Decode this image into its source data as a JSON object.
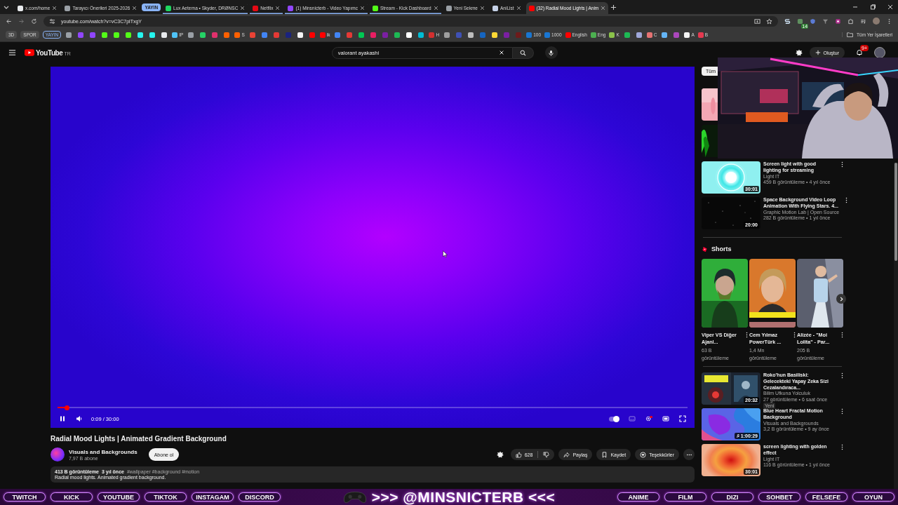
{
  "browser": {
    "tabs": [
      {
        "kind": "tab",
        "title": "x.com/home",
        "selected": false,
        "grouped": false,
        "color": "#e8eaed"
      },
      {
        "kind": "tab",
        "title": "Tarayıcı Önerileri 2025-2026",
        "selected": false,
        "grouped": false,
        "color": "#9aa0a6"
      },
      {
        "kind": "group",
        "title": "YAYIN",
        "color": "#8ab4f8"
      },
      {
        "kind": "tab",
        "title": "Lux Aeterna • Skyder, DRØNSC",
        "selected": false,
        "grouped": true,
        "color": "#1ed760"
      },
      {
        "kind": "tab",
        "title": "Netflix",
        "selected": false,
        "grouped": true,
        "color": "#e50914"
      },
      {
        "kind": "tab",
        "title": "(1) Minsnicterb - Video Yapımc",
        "selected": false,
        "grouped": true,
        "color": "#9146ff"
      },
      {
        "kind": "tab",
        "title": "Stream - Kick Dashboard",
        "selected": false,
        "grouped": true,
        "color": "#53fc18"
      },
      {
        "kind": "tab",
        "title": "Yeni Sekme",
        "selected": false,
        "grouped": false,
        "color": "#9aa0a6"
      },
      {
        "kind": "tab",
        "title": "AniList",
        "selected": false,
        "grouped": false,
        "color": "#c6d2e8"
      },
      {
        "kind": "tab",
        "title": "(32) Radial Mood Lights | Anim",
        "selected": true,
        "grouped": false,
        "color": "#ff0000"
      }
    ],
    "address": "youtube.com/watch?v=vC3C7plTxgY",
    "extension_badge": "14",
    "bookmarks": [
      {
        "kind": "folder",
        "label": "3D"
      },
      {
        "kind": "folder",
        "label": "SPOR"
      },
      {
        "kind": "group",
        "label": "YAYIN",
        "color": "#8ab4f8"
      },
      {
        "kind": "site",
        "color": "#9aa0a6"
      },
      {
        "kind": "site",
        "color": "#9146ff"
      },
      {
        "kind": "site",
        "color": "#9146ff"
      },
      {
        "kind": "site",
        "color": "#53fc18"
      },
      {
        "kind": "site",
        "color": "#53fc18"
      },
      {
        "kind": "site",
        "color": "#53fc18"
      },
      {
        "kind": "site",
        "color": "#25f4ee"
      },
      {
        "kind": "site",
        "color": "#25f4ee"
      },
      {
        "kind": "site",
        "color": "#e8eaed"
      },
      {
        "kind": "site",
        "color": "#4fc3f7",
        "label": "IP"
      },
      {
        "kind": "site",
        "color": "#9aa0a6"
      },
      {
        "kind": "site",
        "color": "#25d366"
      },
      {
        "kind": "site",
        "color": "#e1306c"
      },
      {
        "kind": "site",
        "color": "#ff6000"
      },
      {
        "kind": "site",
        "color": "#ff6000",
        "label": "S"
      },
      {
        "kind": "site",
        "color": "#ea4335"
      },
      {
        "kind": "site",
        "color": "#4285f4"
      },
      {
        "kind": "site",
        "color": "#e53935"
      },
      {
        "kind": "site",
        "color": "#1a237e"
      },
      {
        "kind": "site",
        "color": "#f5f5f5"
      },
      {
        "kind": "site",
        "color": "#ff0000"
      },
      {
        "kind": "site",
        "color": "#ff0000",
        "label": "ik"
      },
      {
        "kind": "site",
        "color": "#4285f4"
      },
      {
        "kind": "site",
        "color": "#e53935"
      },
      {
        "kind": "site",
        "color": "#00c853"
      },
      {
        "kind": "site",
        "color": "#e91e63"
      },
      {
        "kind": "site",
        "color": "#7b1fa2"
      },
      {
        "kind": "site",
        "color": "#1db954"
      },
      {
        "kind": "site",
        "color": "#ffffff"
      },
      {
        "kind": "site",
        "color": "#00bcd4"
      },
      {
        "kind": "site",
        "color": "#d32f2f",
        "label": "H"
      },
      {
        "kind": "site",
        "color": "#9e9e9e"
      },
      {
        "kind": "site",
        "color": "#3f51b5"
      },
      {
        "kind": "site",
        "color": "#bdbdbd"
      },
      {
        "kind": "site",
        "color": "#1565c0"
      },
      {
        "kind": "site",
        "color": "#fdd835"
      },
      {
        "kind": "site",
        "color": "#7b1fa2"
      },
      {
        "kind": "site",
        "color": "#6d1b1b"
      },
      {
        "kind": "site",
        "color": "#1976d2",
        "label": "100"
      },
      {
        "kind": "site",
        "color": "#1976d2",
        "label": "1000"
      },
      {
        "kind": "site",
        "color": "#ff0000",
        "label": "English"
      },
      {
        "kind": "site",
        "color": "#4caf50",
        "label": "Eng"
      },
      {
        "kind": "site",
        "color": "#8bc34a",
        "label": "K"
      },
      {
        "kind": "site",
        "color": "#1db954"
      },
      {
        "kind": "site",
        "color": "#9fa8da"
      },
      {
        "kind": "site",
        "color": "#e57373",
        "label": "C"
      },
      {
        "kind": "site",
        "color": "#64b5f6"
      },
      {
        "kind": "site",
        "color": "#ab47bc"
      },
      {
        "kind": "site",
        "color": "#f5f5f5",
        "label": "A"
      },
      {
        "kind": "site",
        "color": "#e53950",
        "label": "B"
      }
    ],
    "all_bookmarks": "Tüm Yer İşaretleri"
  },
  "youtube": {
    "logo": "YouTube",
    "region": "TR",
    "search": {
      "value": "valorant ayakashi"
    },
    "create": "Oluştur",
    "notifications": "9+"
  },
  "player": {
    "progress": {
      "level": 0.015
    },
    "time": "0:09 / 30:00",
    "playing": true,
    "autoplay": true
  },
  "video": {
    "title": "Radial Mood Lights | Animated Gradient Background",
    "channel": "Visuals and Backgrounds",
    "subscribers": "7,97 B abone",
    "subscribe": "Abone ol",
    "likes": "628",
    "actions": [
      {
        "kind": "share",
        "label": "Paylaş"
      },
      {
        "kind": "save",
        "label": "Kaydet"
      },
      {
        "kind": "thanks",
        "label": "Teşekkürler"
      }
    ],
    "description": {
      "views": "413 B görüntüleme",
      "age": "3 yıl önce",
      "tags": "#wallpaper #background #motion",
      "text": "Radial mood lights. Animated gradient background."
    }
  },
  "sidebar": {
    "chip": "Tüm",
    "videos": [
      {
        "title": "Screen light with good lighting for streaming",
        "channel": "Light IT",
        "meta": "459 B görüntüleme • 4 yıl önce",
        "duration": "30:01"
      },
      {
        "title": "Space Background Video Loop Animation With Flying Stars. 4...",
        "channel": "Graphic Motion Lab | Open Source",
        "meta": "282 B görüntüleme • 1 yıl önce",
        "duration": "20:00"
      }
    ],
    "shorts": {
      "title": "Shorts",
      "items": [
        {
          "title": "Viper VS Diğer Ajanl...",
          "views": "63 B görüntüleme"
        },
        {
          "title": "Cem Yılmaz PowerTürk ...",
          "views": "1,4 Mn görüntüleme"
        },
        {
          "title": "Alizée - \"Moi Lolita\" - Par...",
          "views": "205 B görüntüleme"
        }
      ]
    },
    "more_videos": [
      {
        "title": "Roko'hun Basiliski: Gelecekteki Yapay Zeka Sizi Cezalandıraca...",
        "channel": "Bilim Ufkuna Yolculuk",
        "meta": "27 görüntüleme • 6 saat önce",
        "badge": "Yeni",
        "duration": "20:32",
        "music": false
      },
      {
        "title": "Blue Heart Fractal Motion Background",
        "channel": "Visuals and Backgrounds",
        "meta": "3,2 B görüntüleme • 9 ay önce",
        "duration": "1:00:29",
        "music": true
      },
      {
        "title": "screen lighting with golden effect",
        "channel": "Light IT",
        "meta": "116 B görüntüleme • 1 yıl önce",
        "duration": "30:01",
        "music": false
      }
    ]
  },
  "stream_overlay": {
    "left_links": [
      "TWITCH",
      "KICK",
      "YOUTUBE",
      "TIKTOK",
      "INSTAGAM",
      "DISCORD"
    ],
    "handle": ">>> @MINSNICTERB <<<",
    "right_links": [
      "ANIME",
      "FILM",
      "DIZI",
      "SOHBET",
      "FELSEFE",
      "OYUN"
    ]
  }
}
